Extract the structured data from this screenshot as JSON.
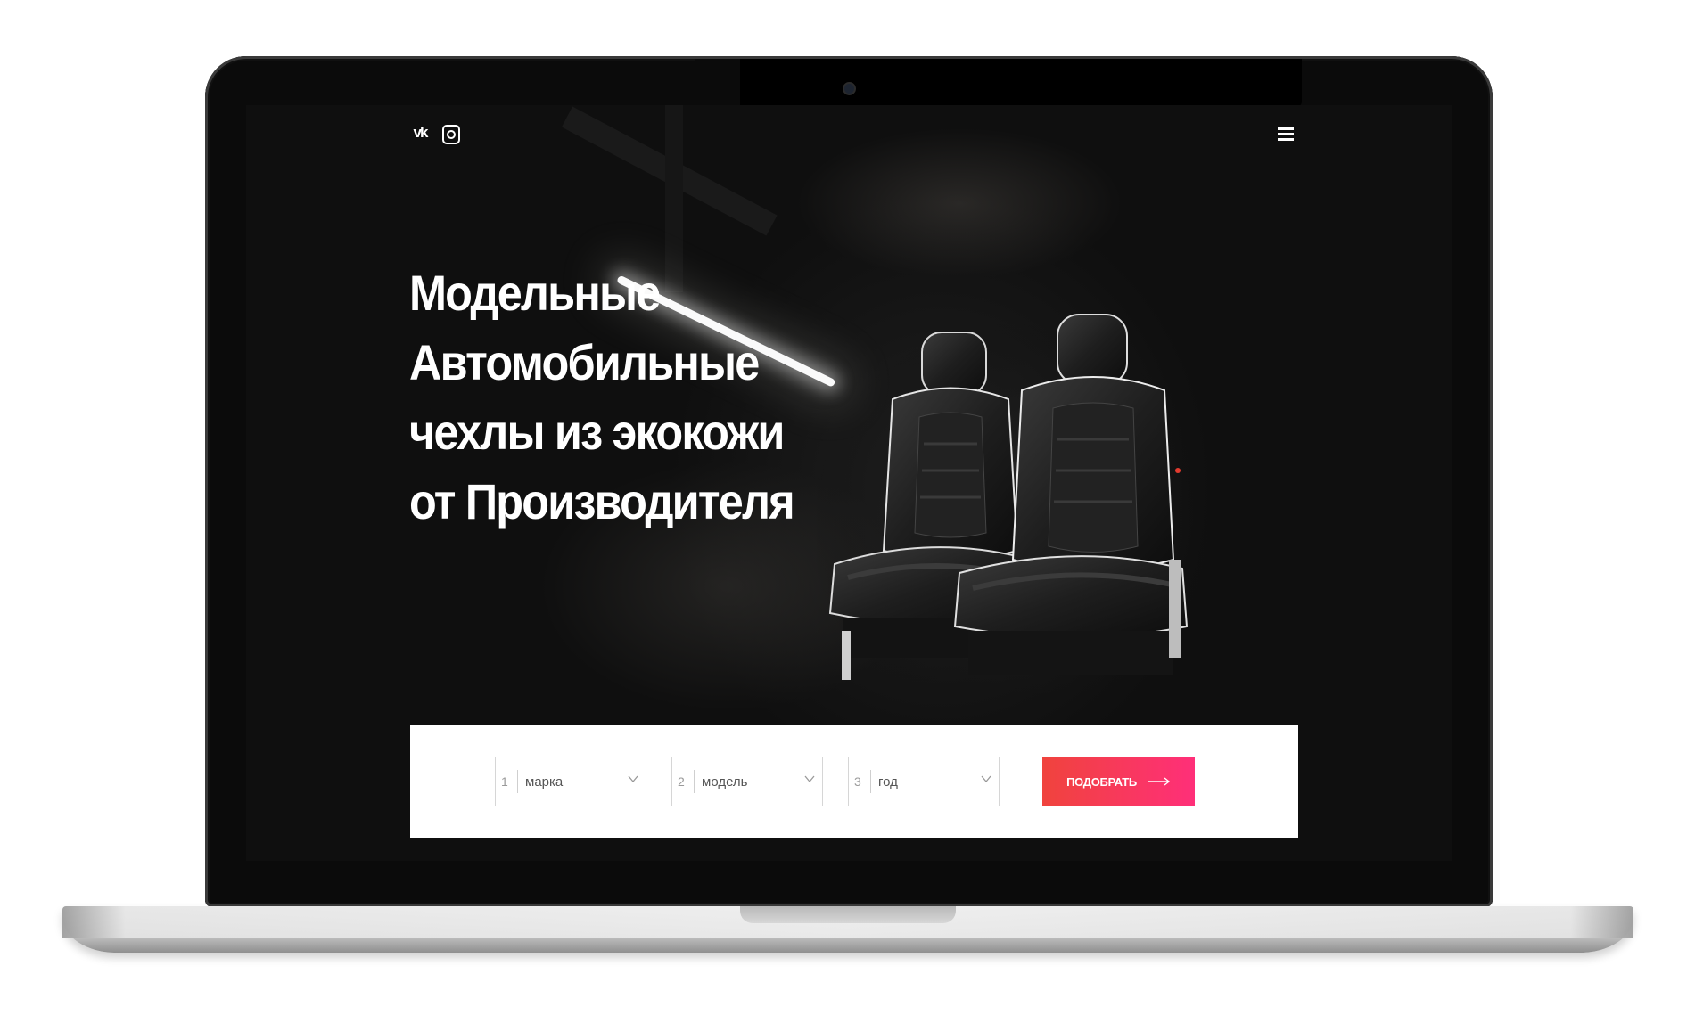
{
  "header": {
    "social": [
      {
        "name": "vk-icon",
        "glyph": "vk"
      },
      {
        "name": "instagram-icon",
        "glyph": ""
      }
    ],
    "menu_icon": "hamburger-menu-icon"
  },
  "hero": {
    "title_lines": [
      "Модельные",
      "Автомобильные",
      "чехлы из экокожи",
      "от Производителя"
    ]
  },
  "filter": {
    "fields": [
      {
        "number": "1",
        "label": "марка"
      },
      {
        "number": "2",
        "label": "модель"
      },
      {
        "number": "3",
        "label": "год"
      }
    ],
    "button_label": "ПОДОБРАТЬ",
    "button_gradient": [
      "#f0433d",
      "#ff2f79"
    ]
  }
}
